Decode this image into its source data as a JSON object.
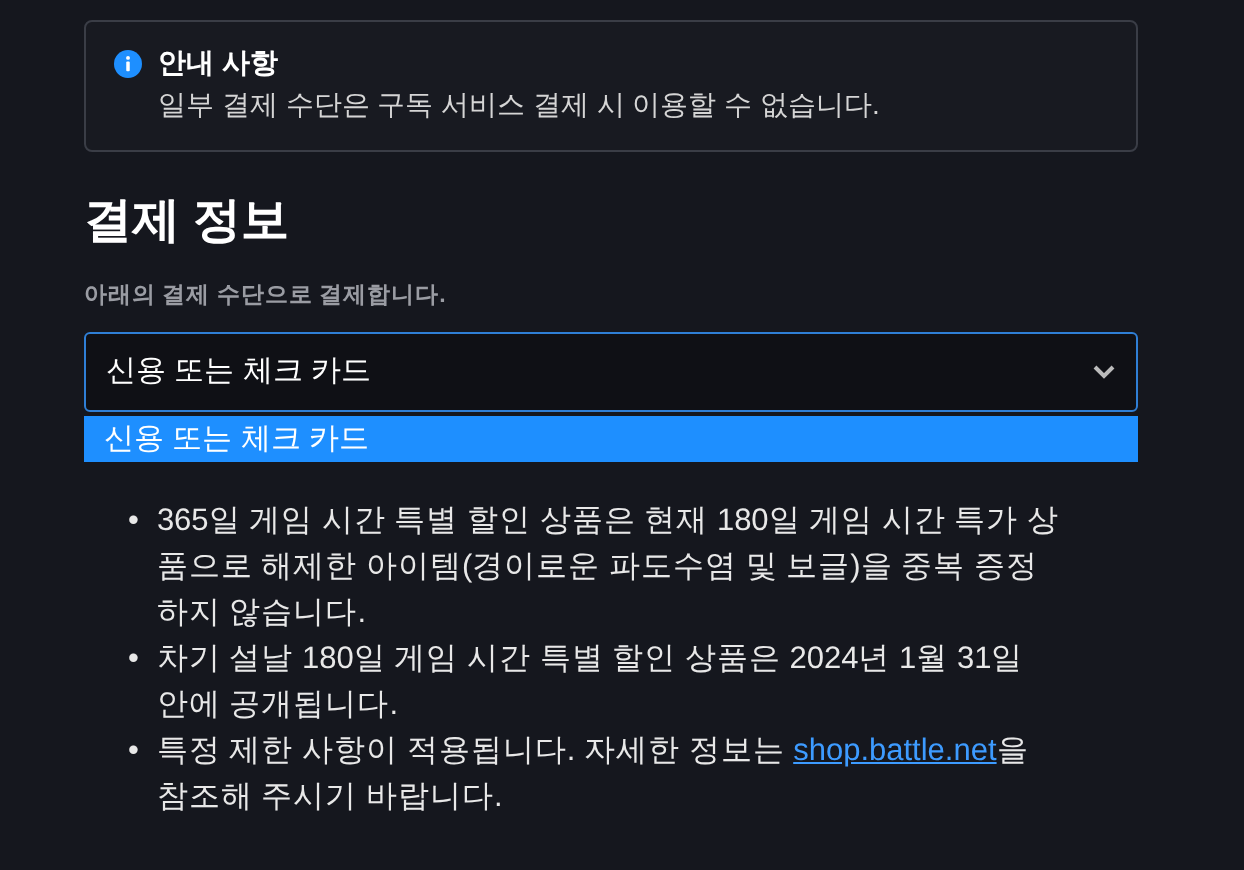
{
  "notice": {
    "title": "안내 사항",
    "message": "일부 결제 수단은 구독 서비스 결제 시 이용할 수 없습니다."
  },
  "payment": {
    "heading": "결제 정보",
    "label": "아래의 결제 수단으로 결제합니다.",
    "select_value": "신용 또는 체크 카드",
    "expanded": true,
    "options": [
      {
        "label": "신용 또는 체크 카드",
        "selected": true
      }
    ]
  },
  "notes": [
    {
      "bullet": "•",
      "parts": [
        {
          "text": "365일 게임 시간 특별 할인 상품은 현재 180일 게임 시간 특가 상품으로 해제한 아이템(경이로운 파도수염 및 보글)을 중복 증정하지 않습니다."
        }
      ]
    },
    {
      "bullet": "•",
      "parts": [
        {
          "text": "차기 설날 180일 게임 시간 특별 할인 상품은 2024년 1월 31일 안에 공개됩니다."
        }
      ]
    },
    {
      "bullet": "•",
      "parts": [
        {
          "text": "특정 제한 사항이 적용됩니다. 자세한 정보는 "
        },
        {
          "text": "shop.battle.net",
          "kind": "link"
        },
        {
          "text": "을 참조해 주시기 바랍니다."
        }
      ]
    }
  ]
}
